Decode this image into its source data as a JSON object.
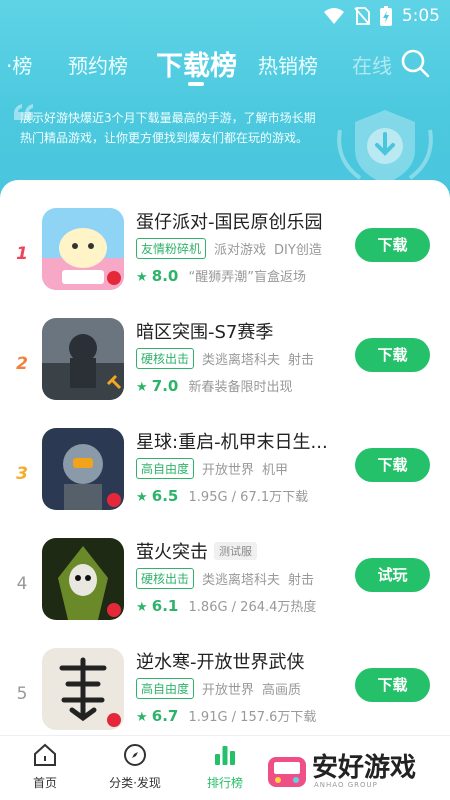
{
  "status_bar": {
    "time": "5:05"
  },
  "tabs": [
    {
      "label": "·榜"
    },
    {
      "label": "预约榜"
    },
    {
      "label": "下载榜"
    },
    {
      "label": "热销榜"
    },
    {
      "label": "在线"
    }
  ],
  "intro": "展示好游快爆近3个月下载量最高的手游，了解市场长期热门精品游戏，让你更方便找到爆友们都在玩的游戏。",
  "games": [
    {
      "rank": "1",
      "title": "蛋仔派对-国民原创乐园",
      "title_tag": "",
      "highlight": "友情粉碎机",
      "tags": [
        "派对游戏",
        "DIY创造"
      ],
      "score": "8.0",
      "meta": "“醒狮弄潮”盲盒返场",
      "button": "下载",
      "icon_color": "#f7a8c7"
    },
    {
      "rank": "2",
      "title": "暗区突围-S7赛季",
      "title_tag": "",
      "highlight": "硬核出击",
      "tags": [
        "类逃离塔科夫",
        "射击"
      ],
      "score": "7.0",
      "meta": "新春装备限时出现",
      "button": "下载",
      "icon_color": "#4a5560"
    },
    {
      "rank": "3",
      "title": "星球:重启-机甲末日生...",
      "title_tag": "",
      "highlight": "高自由度",
      "tags": [
        "开放世界",
        "机甲"
      ],
      "score": "6.5",
      "meta": "1.95G / 67.1万下载",
      "button": "下载",
      "icon_color": "#3a4d66"
    },
    {
      "rank": "4",
      "title": "萤火突击",
      "title_tag": "测试服",
      "highlight": "硬核出击",
      "tags": [
        "类逃离塔科夫",
        "射击"
      ],
      "score": "6.1",
      "meta": "1.86G / 264.4万热度",
      "button": "试玩",
      "icon_color": "#2c3a20"
    },
    {
      "rank": "5",
      "title": "逆水寒-开放世界武侠",
      "title_tag": "",
      "highlight": "高自由度",
      "tags": [
        "开放世界",
        "高画质"
      ],
      "score": "6.7",
      "meta": "1.91G / 157.6万下载",
      "button": "下载",
      "icon_color": "#e8e4dc"
    }
  ],
  "tabbar": [
    {
      "label": "首页",
      "icon": "home-icon"
    },
    {
      "label": "分类·发现",
      "icon": "compass-icon"
    },
    {
      "label": "排行榜",
      "icon": "rank-chart-icon"
    }
  ],
  "watermark": {
    "text": "安好游戏",
    "sub": "ANHAO GROUP"
  },
  "colors": {
    "header": "#4cc9df",
    "accent": "#24c06a",
    "rank1": "#f0435a",
    "rank2": "#f2813a",
    "rank3": "#f5ad2a"
  }
}
